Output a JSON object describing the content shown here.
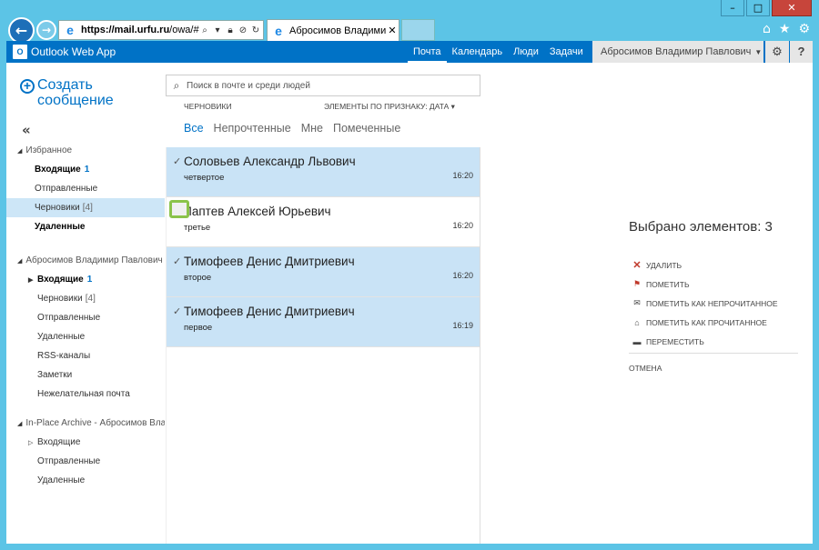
{
  "browser": {
    "address": {
      "host": "https://mail.urfu.ru",
      "path": "/owa/#path"
    },
    "tab_title": "Абросимов Владимир Па...",
    "window_controls": {
      "minimize": "–",
      "maximize": "□",
      "close": "✕"
    }
  },
  "topbar": {
    "app_name": "Outlook Web App",
    "nav": [
      "Почта",
      "Календарь",
      "Люди",
      "Задачи"
    ],
    "active_nav": "Почта",
    "user": "Абросимов Владимир Павлович"
  },
  "compose_label": "Создать сообщение",
  "favorites": {
    "title": "Избранное",
    "items": [
      {
        "label": "Входящие",
        "count": "1"
      },
      {
        "label": "Отправленные",
        "count": ""
      },
      {
        "label": "Черновики",
        "count": "[4]"
      },
      {
        "label": "Удаленные",
        "count": ""
      }
    ]
  },
  "mailbox": {
    "title": "Абросимов Владимир Павлович",
    "items": [
      {
        "label": "Входящие",
        "count": "1"
      },
      {
        "label": "Черновики",
        "count": "[4]"
      },
      {
        "label": "Отправленные",
        "count": ""
      },
      {
        "label": "Удаленные",
        "count": ""
      },
      {
        "label": "RSS-каналы",
        "count": ""
      },
      {
        "label": "Заметки",
        "count": ""
      },
      {
        "label": "Нежелательная почта",
        "count": ""
      }
    ]
  },
  "archive": {
    "title": "In-Place Archive - Абросимов Вла",
    "items": [
      {
        "label": "Входящие"
      },
      {
        "label": "Отправленные"
      },
      {
        "label": "Удаленные"
      }
    ]
  },
  "search_placeholder": "Поиск в почте и среди людей",
  "list": {
    "folder": "ЧЕРНОВИКИ",
    "sort": "ЭЛЕМЕНТЫ ПО ПРИЗНАКУ: ДАТА",
    "filters": [
      "Все",
      "Непрочтенные",
      "Мне",
      "Помеченные"
    ],
    "messages": [
      {
        "sender": "Соловьев Александр Львович",
        "subject": "четвертое",
        "time": "16:20",
        "selected": true
      },
      {
        "sender": "Лаптев Алексей Юрьевич",
        "subject": "третье",
        "time": "16:20",
        "selected": false
      },
      {
        "sender": "Тимофеев Денис Дмитриевич",
        "subject": "второе",
        "time": "16:20",
        "selected": true
      },
      {
        "sender": "Тимофеев Денис Дмитриевич",
        "subject": "первое",
        "time": "16:19",
        "selected": true
      }
    ]
  },
  "reading_pane": {
    "selected_text": "Выбрано элементов: 3",
    "actions": [
      "УДАЛИТЬ",
      "ПОМЕТИТЬ",
      "ПОМЕТИТЬ КАК НЕПРОЧИТАННОЕ",
      "ПОМЕТИТЬ КАК ПРОЧИТАННОЕ",
      "ПЕРЕМЕСТИТЬ"
    ],
    "cancel": "ОТМЕНА"
  },
  "colors": {
    "accent": "#0072c6",
    "selection": "#c9e3f6",
    "highlight_box": "#8bc34a"
  }
}
